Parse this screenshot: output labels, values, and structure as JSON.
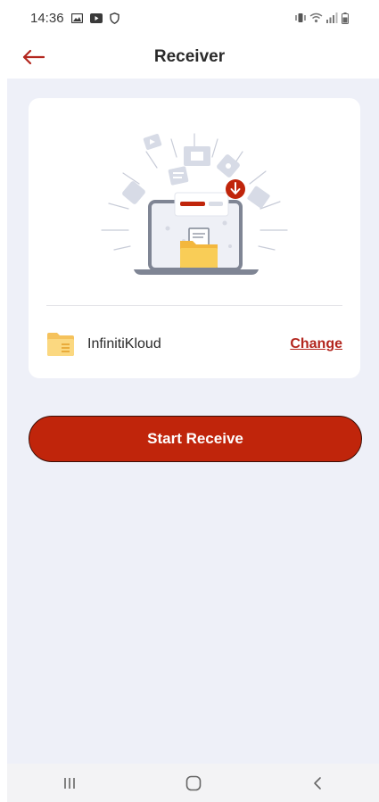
{
  "status_bar": {
    "time": "14:36",
    "left_icons": [
      "gallery-icon",
      "youtube-icon",
      "shield-icon"
    ],
    "right_icons": [
      "vibrate-icon",
      "wifi-icon",
      "signal-icon",
      "battery-icon"
    ]
  },
  "header": {
    "title": "Receiver",
    "back_icon": "arrow-left-icon",
    "accent_color": "#b3261e"
  },
  "card": {
    "illustration": "laptop-receiving-files-illustration",
    "folder_icon": "folder-icon",
    "folder_name": "InfinitiKloud",
    "change_label": "Change"
  },
  "actions": {
    "start_label": "Start Receive",
    "button_color": "#c0250b"
  },
  "nav_bar": {
    "items": [
      "recents-icon",
      "home-icon",
      "back-icon"
    ]
  }
}
